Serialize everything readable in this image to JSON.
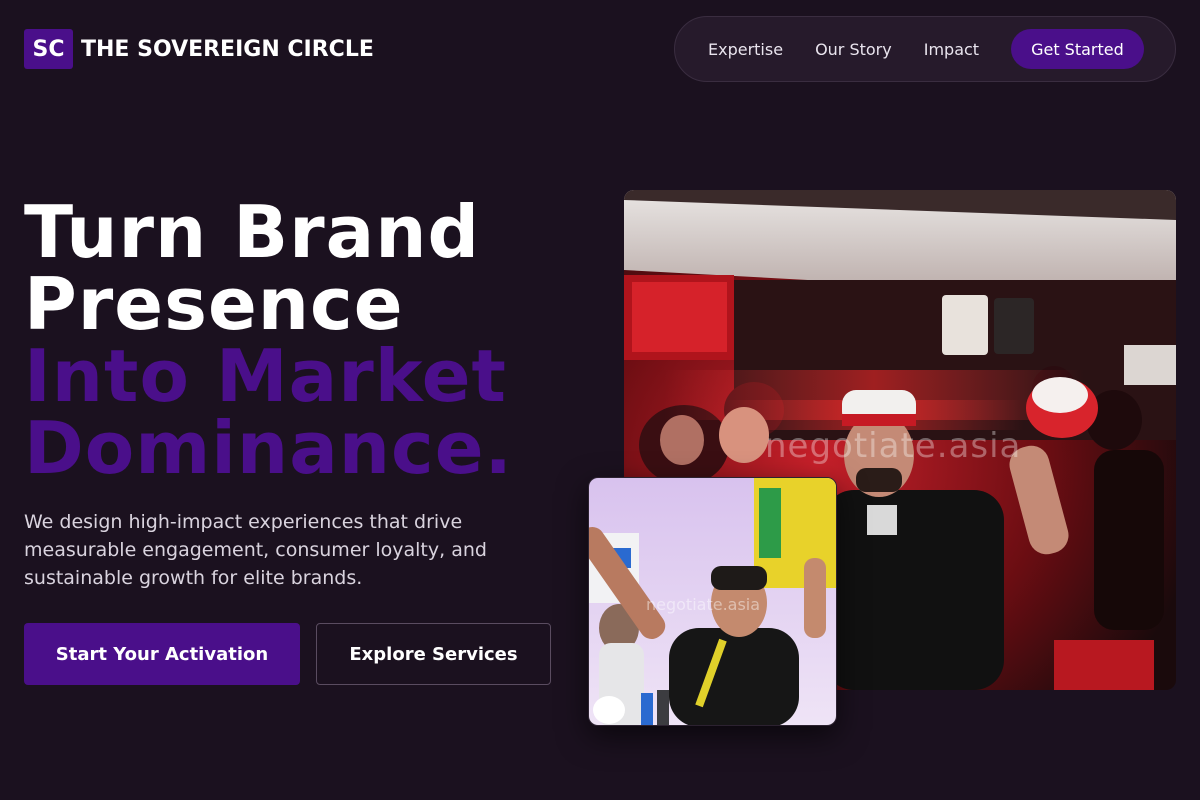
{
  "brand": {
    "mark": "SC",
    "name": "THE SOVEREIGN CIRCLE"
  },
  "nav": {
    "links": [
      "Expertise",
      "Our Story",
      "Impact"
    ],
    "cta": "Get Started"
  },
  "hero": {
    "headline_lines": [
      "Turn Brand",
      "Presence"
    ],
    "headline_accent_lines": [
      "Into Market",
      "Dominance."
    ],
    "subtext": "We design high-impact experiences that drive measurable engagement, consumer loyalty, and sustainable growth for elite brands.",
    "primary_cta": "Start Your Activation",
    "secondary_cta": "Explore Services"
  },
  "images": {
    "main_watermark": "negotiate.asia",
    "small_watermark": "negotiate.asia"
  },
  "colors": {
    "background": "#1b111f",
    "accent": "#4a0f8a",
    "nav_bg": "#261a2b"
  }
}
